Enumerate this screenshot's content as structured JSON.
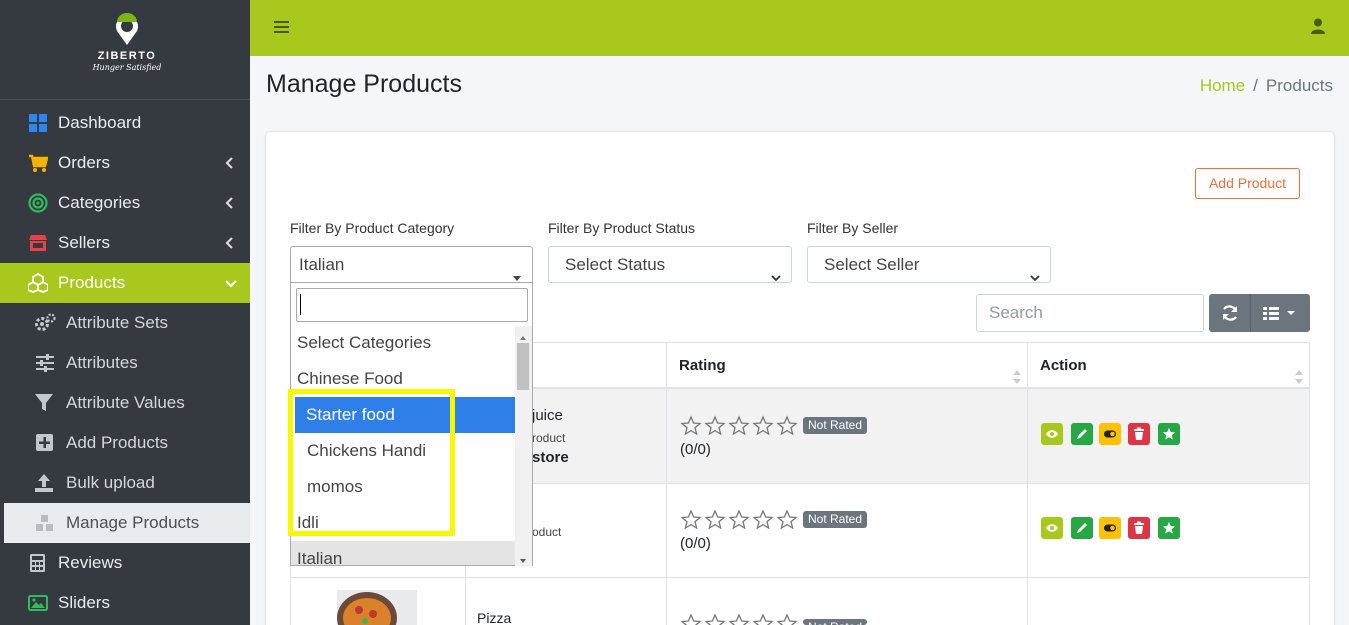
{
  "brand": {
    "name": "ZIBERTO",
    "tagline": "Hunger Satisfied"
  },
  "sidebar": {
    "items": [
      {
        "label": "Dashboard",
        "icon": "dashboard-icon"
      },
      {
        "label": "Orders",
        "icon": "cart-icon"
      },
      {
        "label": "Categories",
        "icon": "target-icon"
      },
      {
        "label": "Sellers",
        "icon": "store-icon"
      },
      {
        "label": "Products",
        "icon": "cubes-icon"
      }
    ],
    "sub_items": [
      {
        "label": "Attribute Sets",
        "icon": "gears-icon"
      },
      {
        "label": "Attributes",
        "icon": "sliders-icon"
      },
      {
        "label": "Attribute Values",
        "icon": "filter-icon"
      },
      {
        "label": "Add Products",
        "icon": "plus-square-icon"
      },
      {
        "label": "Bulk upload",
        "icon": "upload-icon"
      },
      {
        "label": "Manage Products",
        "icon": "cubes-icon"
      }
    ],
    "after_items": [
      {
        "label": "Reviews",
        "icon": "calculator-icon"
      },
      {
        "label": "Sliders",
        "icon": "image-icon"
      }
    ]
  },
  "header": {
    "title": "Manage Products",
    "breadcrumb_home": "Home",
    "breadcrumb_sep": "/",
    "breadcrumb_current": "Products"
  },
  "toolbar": {
    "add_product": "Add Product",
    "search_placeholder": "Search"
  },
  "filters": {
    "category_label": "Filter By Product Category",
    "category_value": "Italian",
    "status_label": "Filter By Product Status",
    "status_value": "Select Status",
    "seller_label": "Filter By Seller",
    "seller_value": "Select Seller"
  },
  "dropdown": {
    "options": [
      "Select Categories",
      "Chinese Food",
      "Starter food",
      "Chickens Handi",
      "momos",
      "Idli",
      "Italian"
    ],
    "highlighted": "Starter food",
    "selected": "Italian"
  },
  "table": {
    "headers": [
      "Rating",
      "Action"
    ],
    "rows": [
      {
        "name_fragment": "juice",
        "type_fragment": "roduct",
        "seller_fragment": "store",
        "rating_badge": "Not Rated",
        "rating_count": "(0/0)"
      },
      {
        "type_fragment": "oduct",
        "rating_badge": "Not Rated",
        "rating_count": "(0/0)"
      },
      {
        "name_fragment": "Pizza",
        "rating_badge": "Not Rated"
      }
    ]
  },
  "colors": {
    "accent": "#a8c81e",
    "sidebar": "#343a40",
    "highlight_box": "#f7f700",
    "option_highlight": "#2f7fe8",
    "add_button": "#e8703a"
  }
}
